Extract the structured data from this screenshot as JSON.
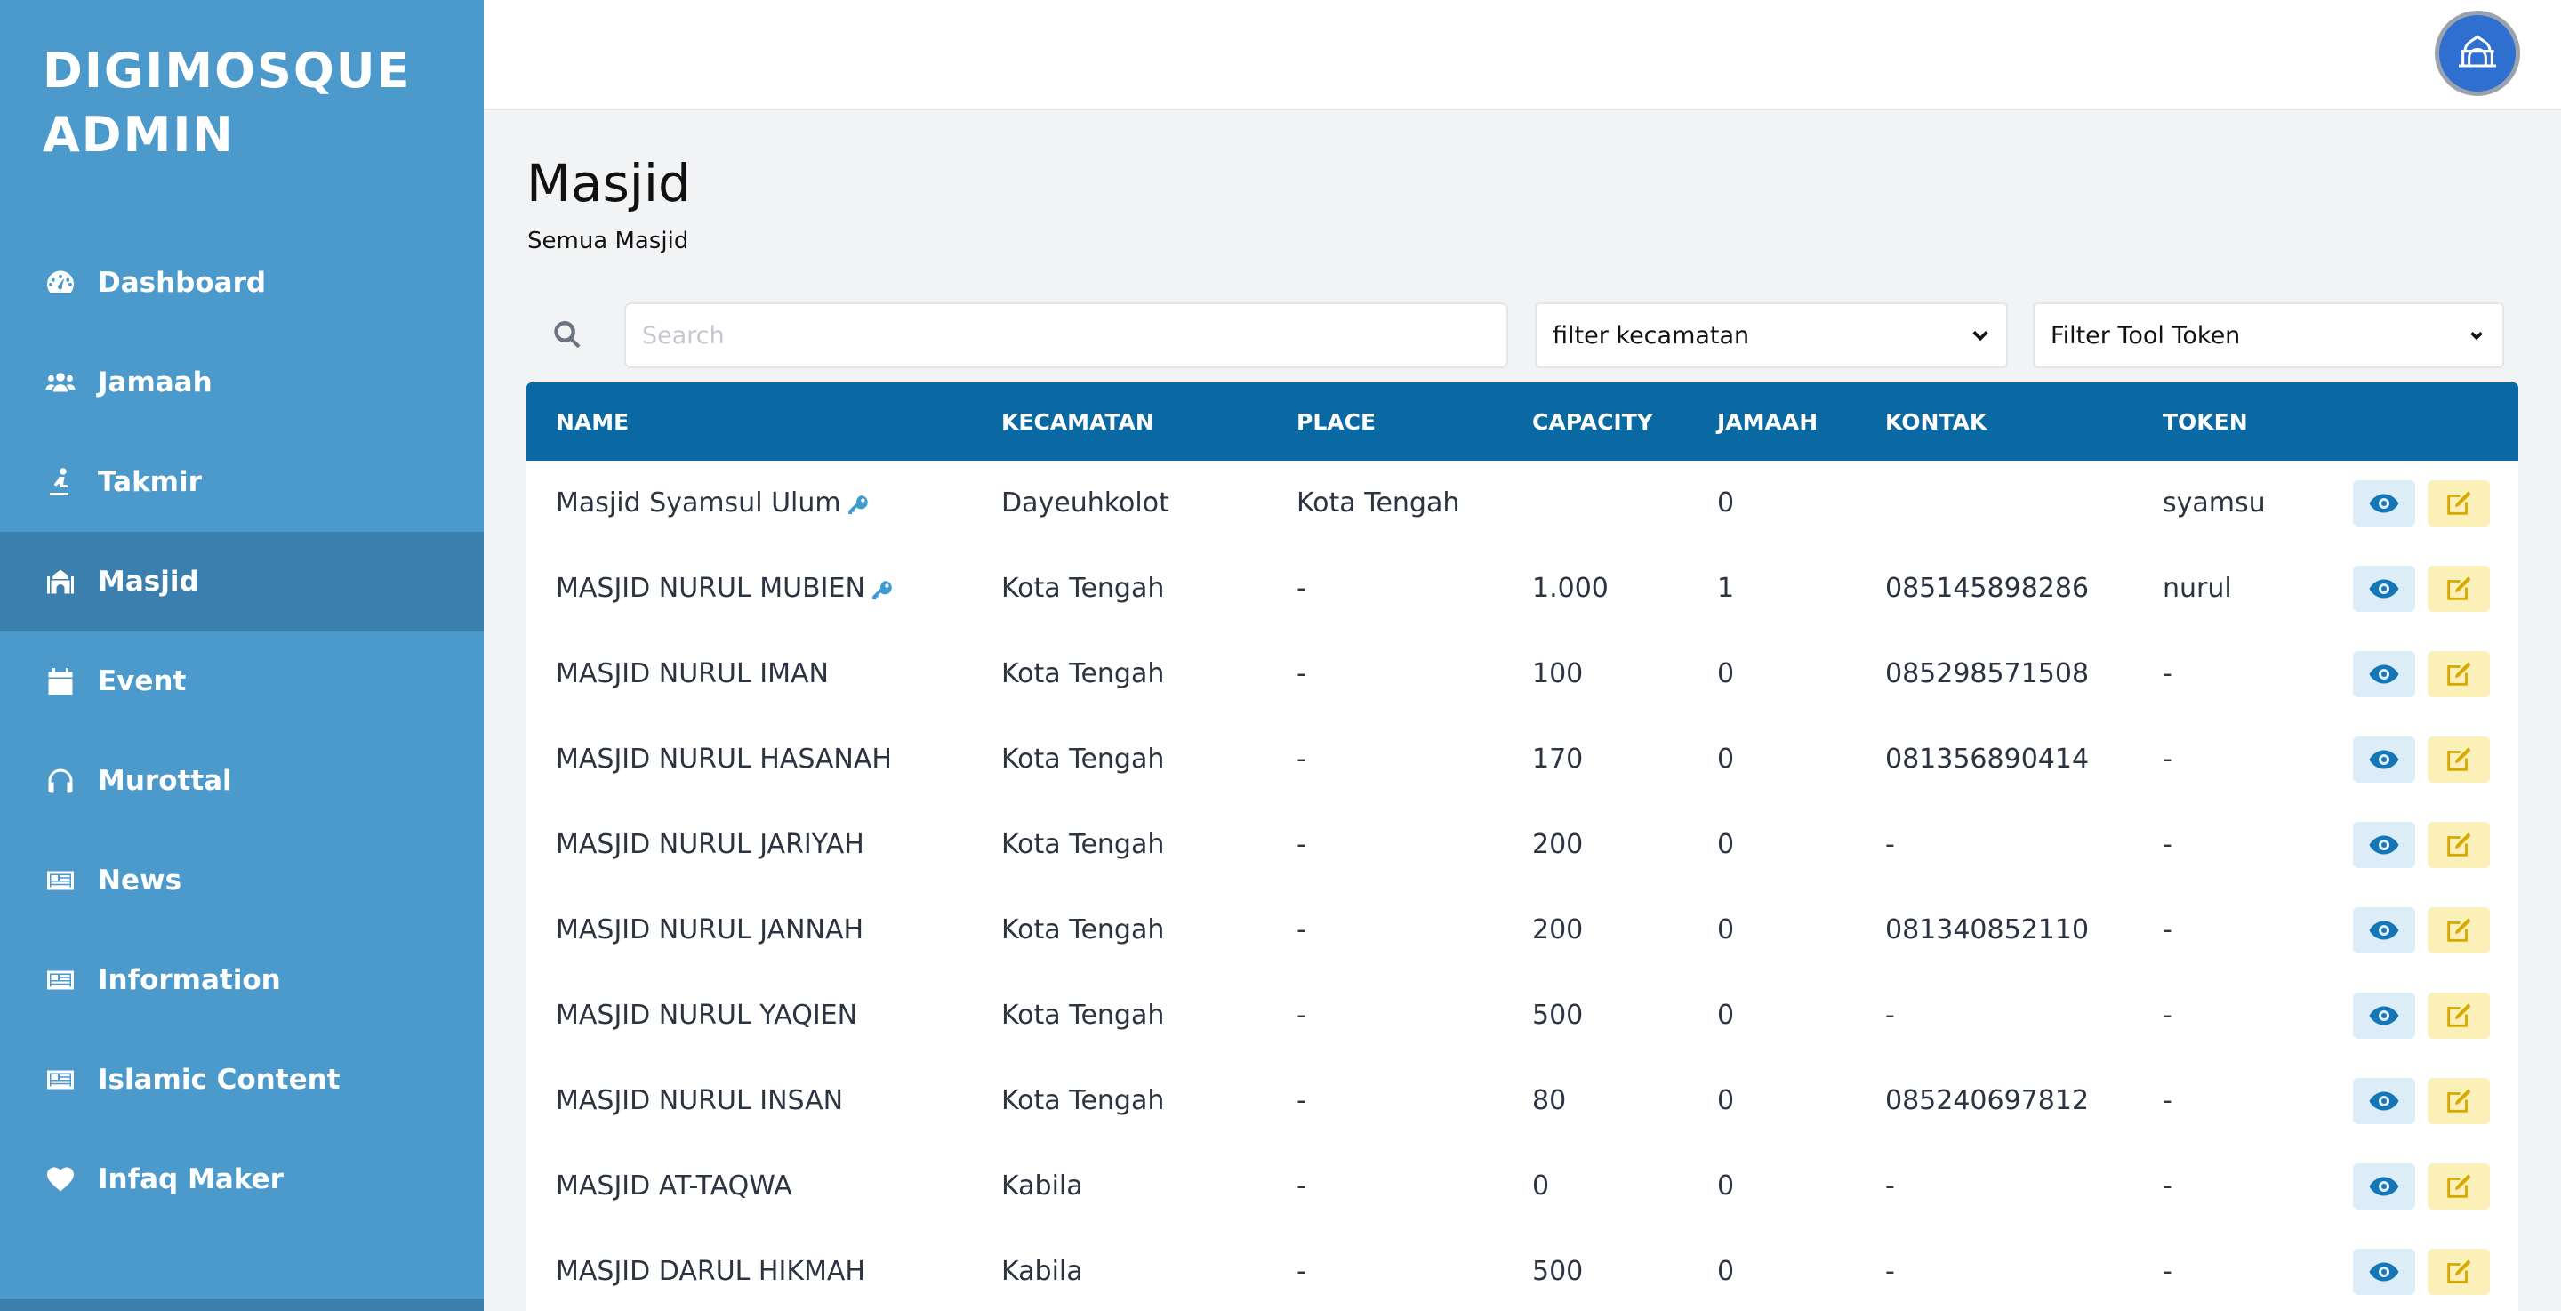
{
  "sidebar": {
    "brand": "DIGIMOSQUE\nADMIN",
    "items": [
      {
        "label": "Dashboard",
        "icon": "dashboard-gauge-icon",
        "active": false
      },
      {
        "label": "Jamaah",
        "icon": "users-icon",
        "active": false
      },
      {
        "label": "Takmir",
        "icon": "person-praying-icon",
        "active": false
      },
      {
        "label": "Masjid",
        "icon": "mosque-icon",
        "active": true
      },
      {
        "label": "Event",
        "icon": "calendar-icon",
        "active": false
      },
      {
        "label": "Murottal",
        "icon": "headphones-icon",
        "active": false
      },
      {
        "label": "News",
        "icon": "newspaper-icon",
        "active": false
      },
      {
        "label": "Information",
        "icon": "newspaper-icon",
        "active": false
      },
      {
        "label": "Islamic Content",
        "icon": "newspaper-icon",
        "active": false
      },
      {
        "label": "Infaq Maker",
        "icon": "heart-icon",
        "active": false
      }
    ]
  },
  "header": {
    "avatar_icon": "digimosque-logo-icon"
  },
  "page": {
    "title": "Masjid",
    "subtitle": "Semua Masjid"
  },
  "filters": {
    "search_placeholder": "Search",
    "kecamatan_selected": "filter kecamatan",
    "token_selected": "Filter Tool Token"
  },
  "table": {
    "headers": {
      "name": "NAME",
      "kecamatan": "KECAMATAN",
      "place": "PLACE",
      "capacity": "CAPACITY",
      "jamaah": "JAMAAH",
      "kontak": "KONTAK",
      "token": "TOKEN"
    },
    "rows": [
      {
        "name": "Masjid Syamsul Ulum",
        "has_key": true,
        "kecamatan": "Dayeuhkolot",
        "place": "Kota Tengah",
        "capacity": "",
        "jamaah": "0",
        "kontak": "",
        "token": "syamsu"
      },
      {
        "name": "MASJID NURUL MUBIEN",
        "has_key": true,
        "kecamatan": "Kota Tengah",
        "place": "-",
        "capacity": "1.000",
        "jamaah": "1",
        "kontak": "085145898286",
        "token": "nurul"
      },
      {
        "name": "MASJID NURUL IMAN",
        "has_key": false,
        "kecamatan": "Kota Tengah",
        "place": "-",
        "capacity": "100",
        "jamaah": "0",
        "kontak": "085298571508",
        "token": "-"
      },
      {
        "name": "MASJID NURUL HASANAH",
        "has_key": false,
        "kecamatan": "Kota Tengah",
        "place": "-",
        "capacity": "170",
        "jamaah": "0",
        "kontak": "081356890414",
        "token": "-"
      },
      {
        "name": "MASJID NURUL JARIYAH",
        "has_key": false,
        "kecamatan": "Kota Tengah",
        "place": "-",
        "capacity": "200",
        "jamaah": "0",
        "kontak": "-",
        "token": "-"
      },
      {
        "name": "MASJID NURUL JANNAH",
        "has_key": false,
        "kecamatan": "Kota Tengah",
        "place": "-",
        "capacity": "200",
        "jamaah": "0",
        "kontak": "081340852110",
        "token": "-"
      },
      {
        "name": "MASJID NURUL YAQIEN",
        "has_key": false,
        "kecamatan": "Kota Tengah",
        "place": "-",
        "capacity": "500",
        "jamaah": "0",
        "kontak": "-",
        "token": "-"
      },
      {
        "name": "MASJID NURUL INSAN",
        "has_key": false,
        "kecamatan": "Kota Tengah",
        "place": "-",
        "capacity": "80",
        "jamaah": "0",
        "kontak": "085240697812",
        "token": "-"
      },
      {
        "name": "MASJID AT-TAQWA",
        "has_key": false,
        "kecamatan": "Kabila",
        "place": "-",
        "capacity": "0",
        "jamaah": "0",
        "kontak": "-",
        "token": "-"
      },
      {
        "name": "MASJID DARUL HIKMAH",
        "has_key": false,
        "kecamatan": "Kabila",
        "place": "-",
        "capacity": "500",
        "jamaah": "0",
        "kontak": "-",
        "token": "-"
      }
    ]
  },
  "colors": {
    "sidebar": "#4b9acb",
    "sidebar_active": "#3a7fae",
    "table_header": "#0a68a3",
    "view_button": "#dcedf8",
    "edit_button": "#fbf0b8"
  }
}
